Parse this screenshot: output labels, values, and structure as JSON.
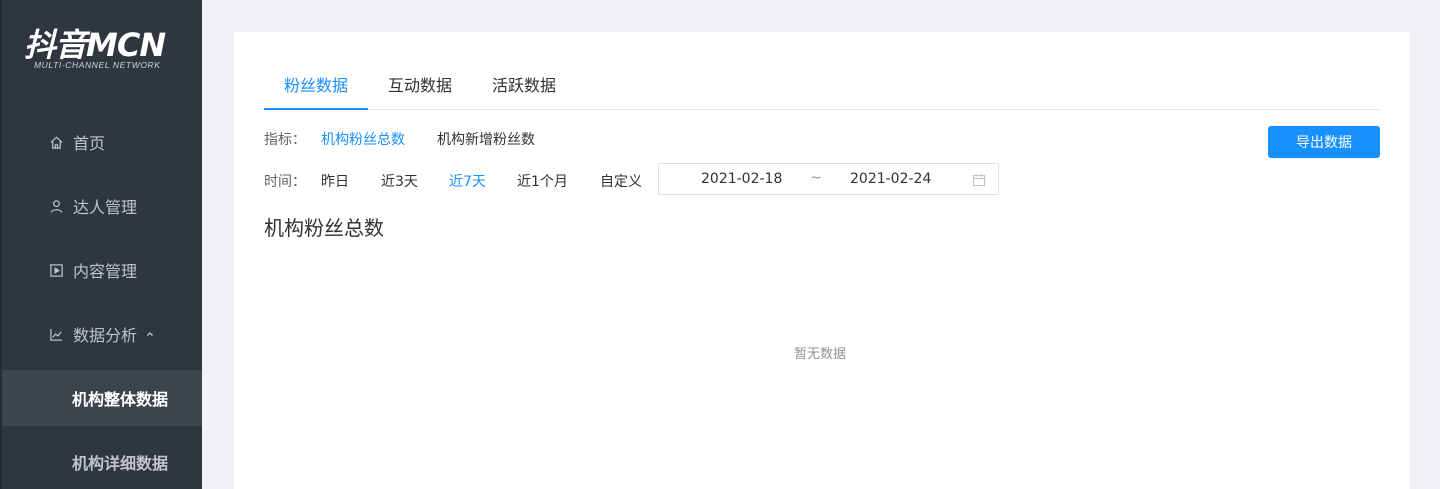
{
  "logo": {
    "main": "抖音MCN",
    "sub": "MULTI-CHANNEL NETWORK"
  },
  "sidebar": {
    "items": [
      {
        "label": "首页",
        "icon": "home-icon"
      },
      {
        "label": "达人管理",
        "icon": "user-icon"
      },
      {
        "label": "内容管理",
        "icon": "play-square-icon"
      },
      {
        "label": "数据分析",
        "icon": "line-chart-icon",
        "expanded": true
      }
    ],
    "sub_items": [
      {
        "label": "机构整体数据",
        "active": true
      },
      {
        "label": "机构详细数据",
        "active": false
      }
    ]
  },
  "tabs": [
    {
      "label": "粉丝数据",
      "active": true
    },
    {
      "label": "互动数据",
      "active": false
    },
    {
      "label": "活跃数据",
      "active": false
    }
  ],
  "metrics": {
    "label": "指标：",
    "options": [
      {
        "label": "机构粉丝总数",
        "active": true
      },
      {
        "label": "机构新增粉丝数",
        "active": false
      }
    ]
  },
  "time": {
    "label": "时间：",
    "options": [
      {
        "label": "昨日",
        "active": false
      },
      {
        "label": "近3天",
        "active": false
      },
      {
        "label": "近7天",
        "active": true
      },
      {
        "label": "近1个月",
        "active": false
      },
      {
        "label": "自定义",
        "active": false
      }
    ],
    "range": {
      "start": "2021-02-18",
      "separator": "~",
      "end": "2021-02-24"
    }
  },
  "export_label": "导出数据",
  "section_title": "机构粉丝总数",
  "empty_text": "暂无数据",
  "colors": {
    "primary": "#1890ff",
    "sidebar_bg": "#2f3640",
    "sidebar_active": "#3d444e"
  }
}
